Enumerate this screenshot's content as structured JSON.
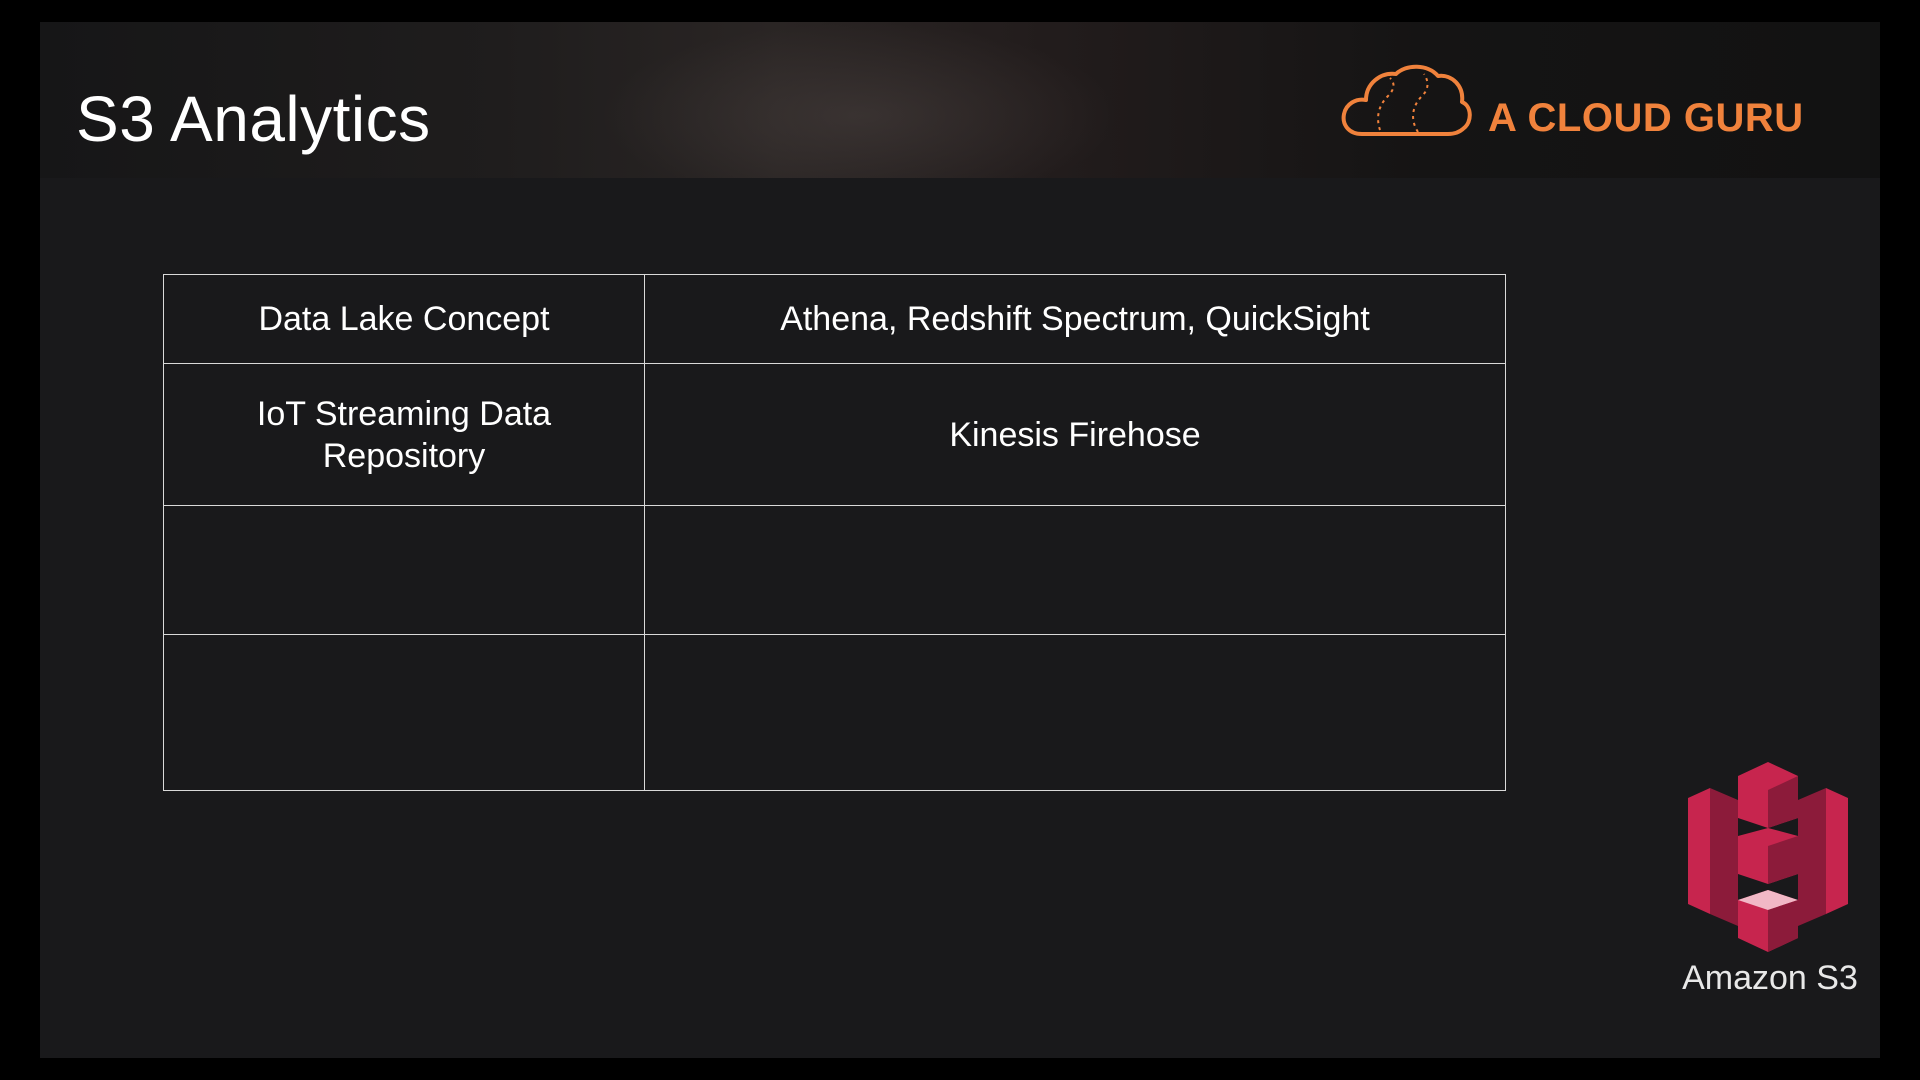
{
  "slide": {
    "title": "S3 Analytics"
  },
  "brand": {
    "name": "A CLOUD GURU",
    "color": "#f0823c",
    "icon": "cloud-logo-icon"
  },
  "table": {
    "rows": [
      {
        "left": "Data Lake Concept",
        "right": "Athena, Redshift Spectrum, QuickSight"
      },
      {
        "left": "IoT Streaming Data Repository",
        "right": "Kinesis Firehose"
      },
      {
        "left": "",
        "right": ""
      },
      {
        "left": "",
        "right": ""
      }
    ]
  },
  "service": {
    "label": "Amazon S3",
    "icon": "amazon-s3-icon",
    "color": "#c7254e"
  }
}
